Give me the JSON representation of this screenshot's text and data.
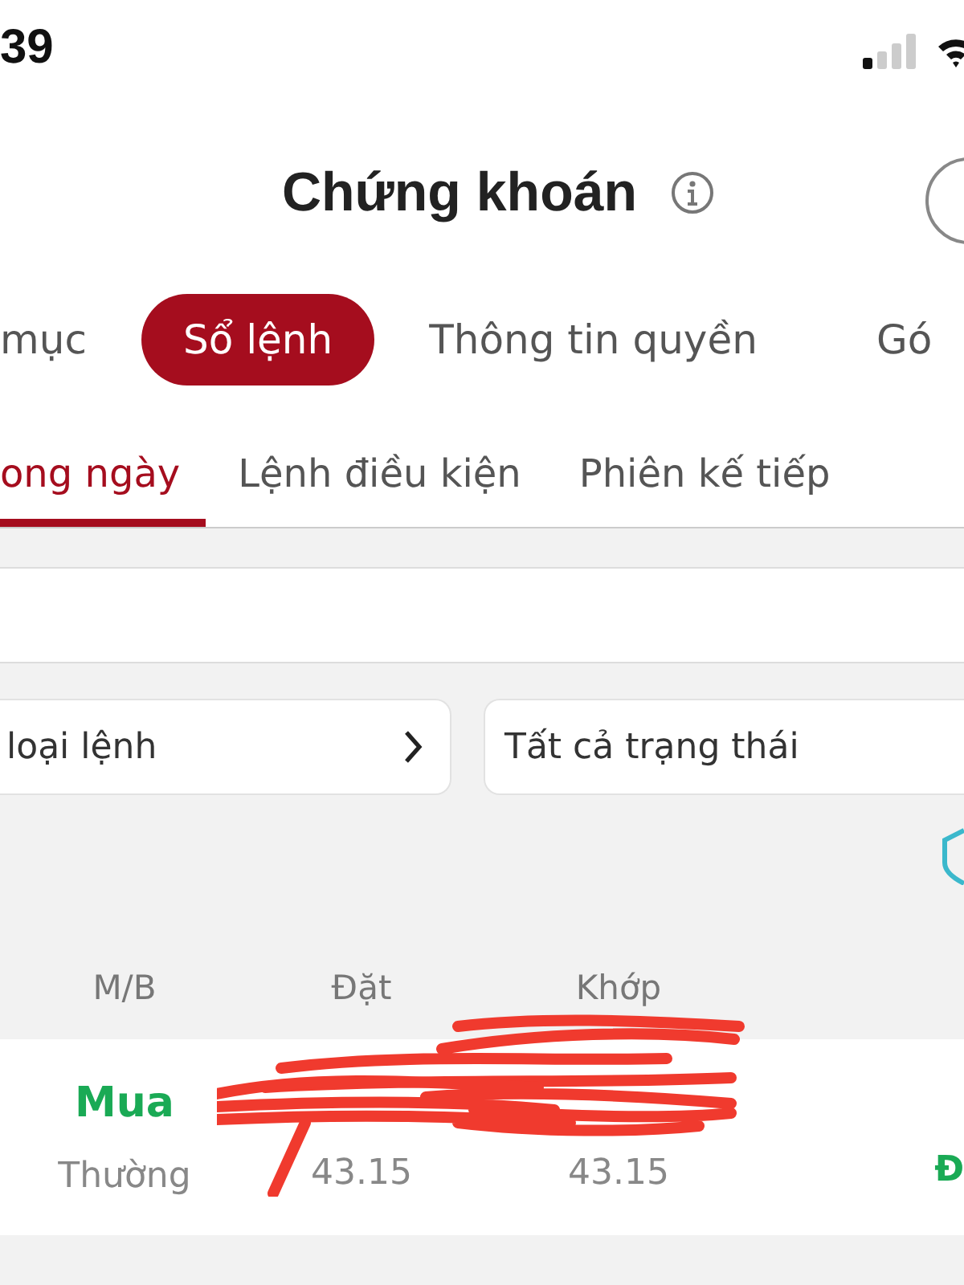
{
  "status_bar": {
    "time": "39"
  },
  "header": {
    "title": "Chứng khoán"
  },
  "category_tabs": [
    {
      "label": "mục",
      "selected": false
    },
    {
      "label": "Sổ lệnh",
      "selected": true
    },
    {
      "label": "Thông tin quyền",
      "selected": false
    },
    {
      "label": "Gó",
      "selected": false
    }
  ],
  "order_tabs": [
    {
      "label": "ong ngày",
      "selected": true
    },
    {
      "label": "Lệnh điều kiện",
      "selected": false
    },
    {
      "label": "Phiên kế tiếp",
      "selected": false
    }
  ],
  "filters": [
    {
      "value": "loại lệnh",
      "kind": "arrow"
    },
    {
      "value": "Tất cả trạng thái",
      "kind": "plain"
    }
  ],
  "table": {
    "columns": [
      "M/B",
      "Đặt",
      "Khớp"
    ],
    "rows": [
      {
        "side": "Mua",
        "type": "Thường",
        "order_price": "43.15",
        "matched_price": "43.15",
        "status": "Đ"
      }
    ]
  }
}
